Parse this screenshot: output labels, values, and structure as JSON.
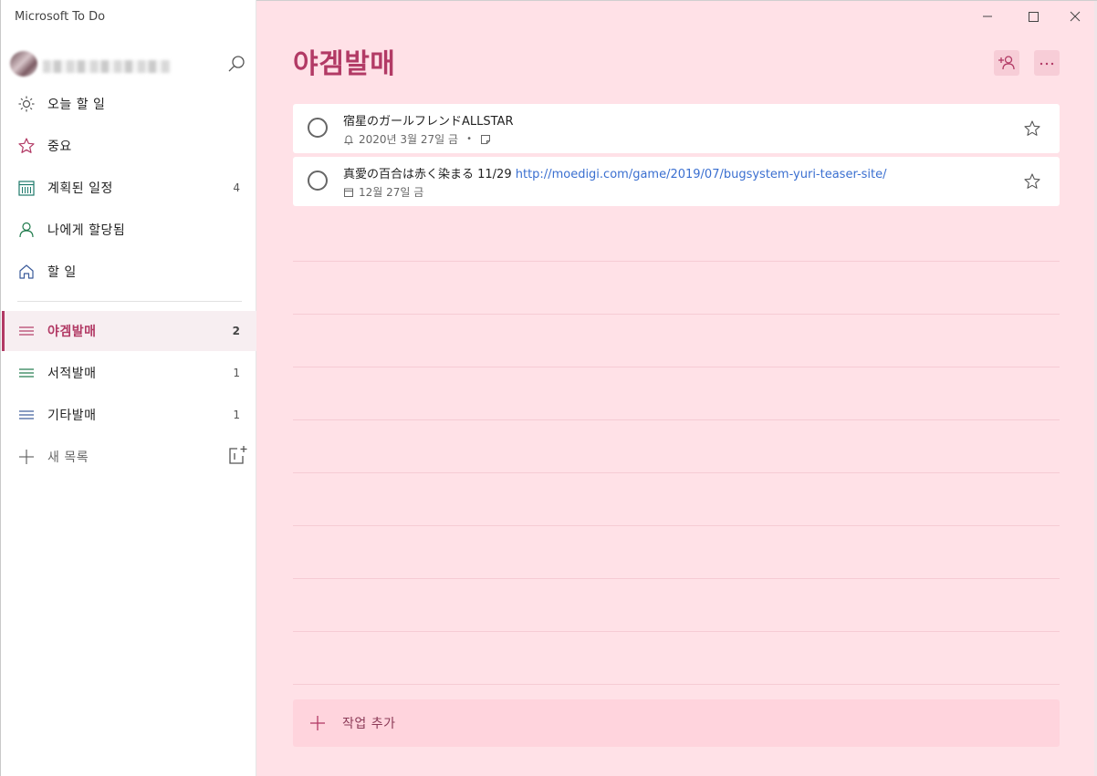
{
  "app": {
    "title": "Microsoft To Do"
  },
  "colors": {
    "accent": "#b23a65",
    "main_bg": "#ffe1e7",
    "task_bg": "#ffffff",
    "add_bg": "#ffd4dd"
  },
  "sidebar": {
    "nav": [
      {
        "label": "오늘 할 일",
        "count": "",
        "icon": "sun-icon"
      },
      {
        "label": "중요",
        "count": "",
        "icon": "star-icon"
      },
      {
        "label": "계획된 일정",
        "count": "4",
        "icon": "calendar-icon"
      },
      {
        "label": "나에게 할당됨",
        "count": "",
        "icon": "person-icon"
      },
      {
        "label": "할 일",
        "count": "",
        "icon": "home-icon"
      }
    ],
    "lists": [
      {
        "label": "야겜발매",
        "count": "2",
        "icon": "list-icon",
        "active": true
      },
      {
        "label": "서적발매",
        "count": "1",
        "icon": "list-icon",
        "active": false
      },
      {
        "label": "기타발매",
        "count": "1",
        "icon": "list-icon",
        "active": false
      }
    ],
    "new_list_label": "새 목록"
  },
  "main": {
    "list_title": "야겜발매",
    "tasks": [
      {
        "title": "宿星のガールフレンドALLSTAR",
        "link": "",
        "date": "2020년 3월 27일 금",
        "date_icon": "bell-icon",
        "has_note": true
      },
      {
        "title": "真愛の百合は赤く染まる 11/29",
        "link": "http://moedigi.com/game/2019/07/bugsystem-yuri-teaser-site/",
        "date": "12월 27일 금",
        "date_icon": "calendar-icon",
        "has_note": false
      }
    ],
    "add_task_placeholder": "작업 추가"
  }
}
